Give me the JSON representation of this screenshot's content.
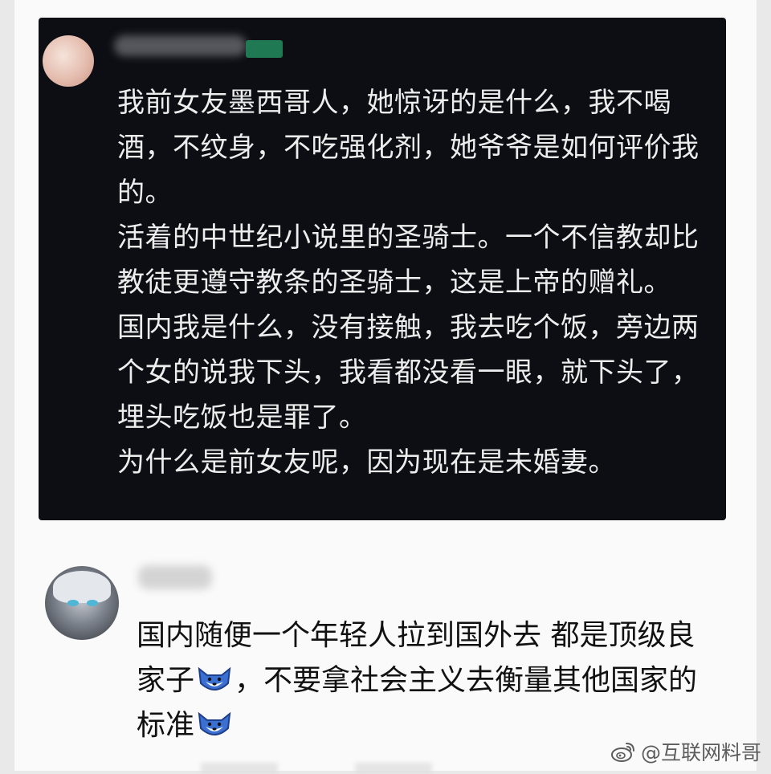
{
  "post": {
    "paragraphs": [
      "我前女友墨西哥人，她惊讶的是什么，我不喝酒，不纹身，不吃强化剂，她爷爷是如何评价我的。",
      "活着的中世纪小说里的圣骑士。一个不信教却比教徒更遵守教条的圣骑士，这是上帝的赠礼。",
      "国内我是什么，没有接触，我去吃个饭，旁边两个女的说我下头，我看都没看一眼，就下头了，埋头吃饭也是罪了。",
      "为什么是前女友呢，因为现在是未婚妻。"
    ]
  },
  "comment": {
    "text_part1": "国内随便一个年轻人拉到国外去 都是顶级良家子",
    "emoji1": "dog-emoji",
    "text_part2": "，不要拿社会主义去衡量其他国家的标准",
    "emoji2": "dog-emoji"
  },
  "watermark": {
    "icon": "weibo-icon",
    "text": "@互联网料哥"
  },
  "colors": {
    "dark_card": "#0d0e14",
    "dark_text": "#ededed",
    "comment_text": "#111111",
    "watermark": "#5c5c5c"
  }
}
